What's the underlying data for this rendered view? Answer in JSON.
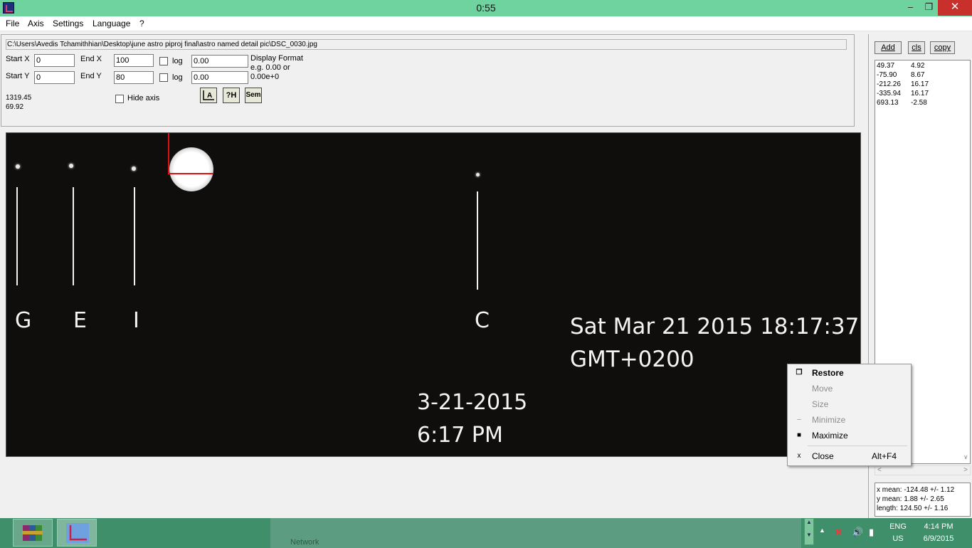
{
  "window": {
    "title": "0:55",
    "buttons": {
      "minimize": "–",
      "restore": "❐",
      "close": "✕"
    }
  },
  "menu": [
    "File",
    "Axis",
    "Settings",
    "Language",
    "?"
  ],
  "path": "C:\\Users\\Avedis Tchamithhian\\Desktop\\june astro piproj final\\astro named detail pic\\DSC_0030.jpg",
  "axis": {
    "start_x_label": "Start X",
    "start_x": "0",
    "end_x_label": "End X",
    "end_x": "100",
    "start_y_label": "Start Y",
    "start_y": "0",
    "end_y_label": "End Y",
    "end_y": "80",
    "log_label": "log",
    "format_x": "0.00",
    "format_y": "0.00",
    "display_format_label": "Display Format",
    "display_format_eg": "e.g. 0.00 or",
    "display_format_sci": "0.00e+0"
  },
  "cursor": {
    "x": "1319.45",
    "y": "69.92"
  },
  "hide_axis_label": "Hide axis",
  "toolbar": {
    "axis_tool": "A",
    "help_tool": "?H",
    "sem_tool": "Sem"
  },
  "image": {
    "labels": {
      "g": "G",
      "e": "E",
      "i": "I",
      "c": "C"
    },
    "timestamp_line1": "Sat Mar 21 2015 18:17:37",
    "timestamp_line2": "GMT+0200",
    "date_line1": "3-21-2015",
    "date_line2": "6:17 PM"
  },
  "right_panel": {
    "add_label": "Add",
    "cls_label": "cls",
    "copy_label": "copy",
    "results": [
      {
        "x": "49.37",
        "y": "4.92"
      },
      {
        "x": "-75.90",
        "y": "8.67"
      },
      {
        "x": "-212.26",
        "y": "16.17"
      },
      {
        "x": "-335.94",
        "y": "16.17"
      },
      {
        "x": "693.13",
        "y": "-2.58"
      }
    ],
    "x_mean": "x mean: -124.48 +/- 1.12",
    "y_mean": "y mean: 1.88 +/- 2.65",
    "length": "length: 124.50 +/- 1.16"
  },
  "context_menu": {
    "restore": "Restore",
    "move": "Move",
    "size": "Size",
    "minimize": "Minimize",
    "maximize": "Maximize",
    "close": "Close",
    "close_key": "Alt+F4"
  },
  "taskbar": {
    "network_label": "Network",
    "lang": "ENG",
    "region": "US",
    "time": "4:14 PM",
    "date": "6/9/2015"
  }
}
